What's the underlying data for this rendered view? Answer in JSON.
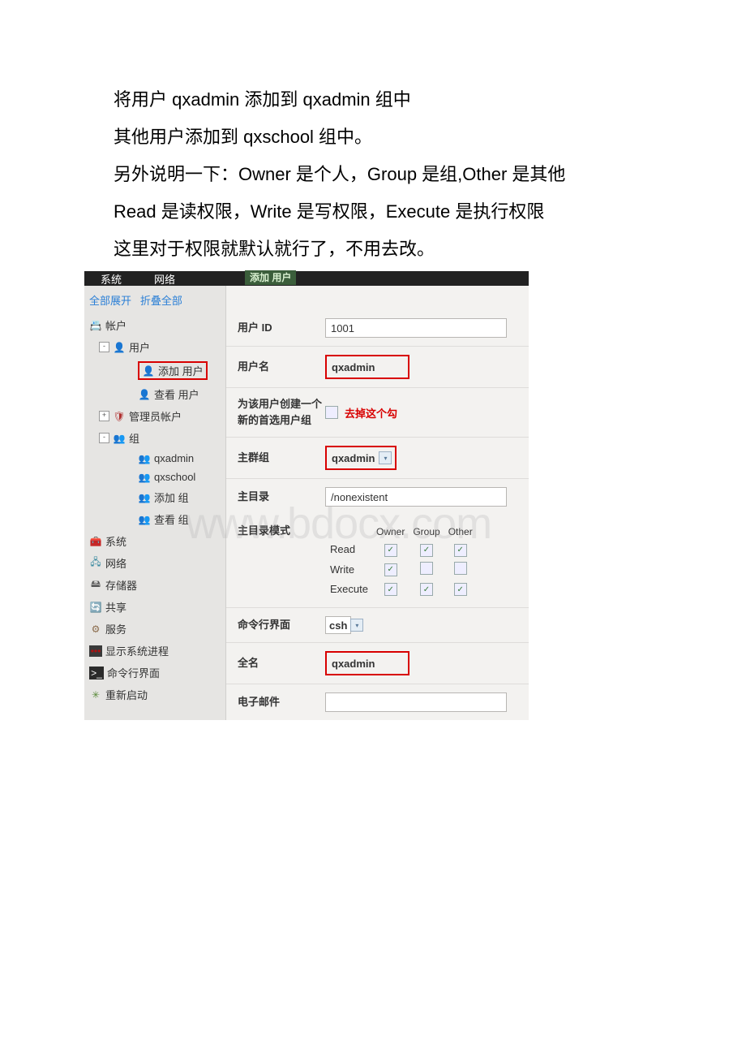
{
  "paragraph": {
    "l1": "将用户 qxadmin 添加到 qxadmin 组中",
    "l2": "其他用户添加到 qxschool 组中。",
    "l3": "另外说明一下：Owner 是个人，Group 是组,Other 是其他",
    "l4": "Read 是读权限，Write 是写权限，Execute 是执行权限",
    "l5": "这里对于权限就默认就行了，不用去改。"
  },
  "header": {
    "tab_system": "系统",
    "tab_network": "网络",
    "panel_title": "添加 用户"
  },
  "sidebar": {
    "expand_all": "全部展开",
    "collapse_all": "折叠全部",
    "account": "帐户",
    "user": "用户",
    "add_user": "添加 用户",
    "view_user": "查看 用户",
    "admin_account": "管理员帐户",
    "group": "组",
    "group_qxadmin": "qxadmin",
    "group_qxschool": "qxschool",
    "add_group": "添加 组",
    "view_group": "查看 组",
    "system": "系统",
    "network": "网络",
    "storage": "存储器",
    "share": "共享",
    "service": "服务",
    "show_proc": "显示系统进程",
    "cli": "命令行界面",
    "reboot": "重新启动"
  },
  "form": {
    "user_id_label": "用户 ID",
    "user_id_value": "1001",
    "username_label": "用户名",
    "username_value": "qxadmin",
    "newgroup_label": "为该用户创建一个新的首选用户组",
    "newgroup_note": "去掉这个勾",
    "primary_group_label": "主群组",
    "primary_group_value": "qxadmin",
    "home_label": "主目录",
    "home_value": "/nonexistent",
    "home_mode_label": "主目录模式",
    "perm_owner": "Owner",
    "perm_group": "Group",
    "perm_other": "Other",
    "perm_read": "Read",
    "perm_write": "Write",
    "perm_execute": "Execute",
    "shell_label": "命令行界面",
    "shell_value": "csh",
    "fullname_label": "全名",
    "fullname_value": "qxadmin",
    "email_label": "电子邮件"
  },
  "watermark": "www.bdocx.com"
}
